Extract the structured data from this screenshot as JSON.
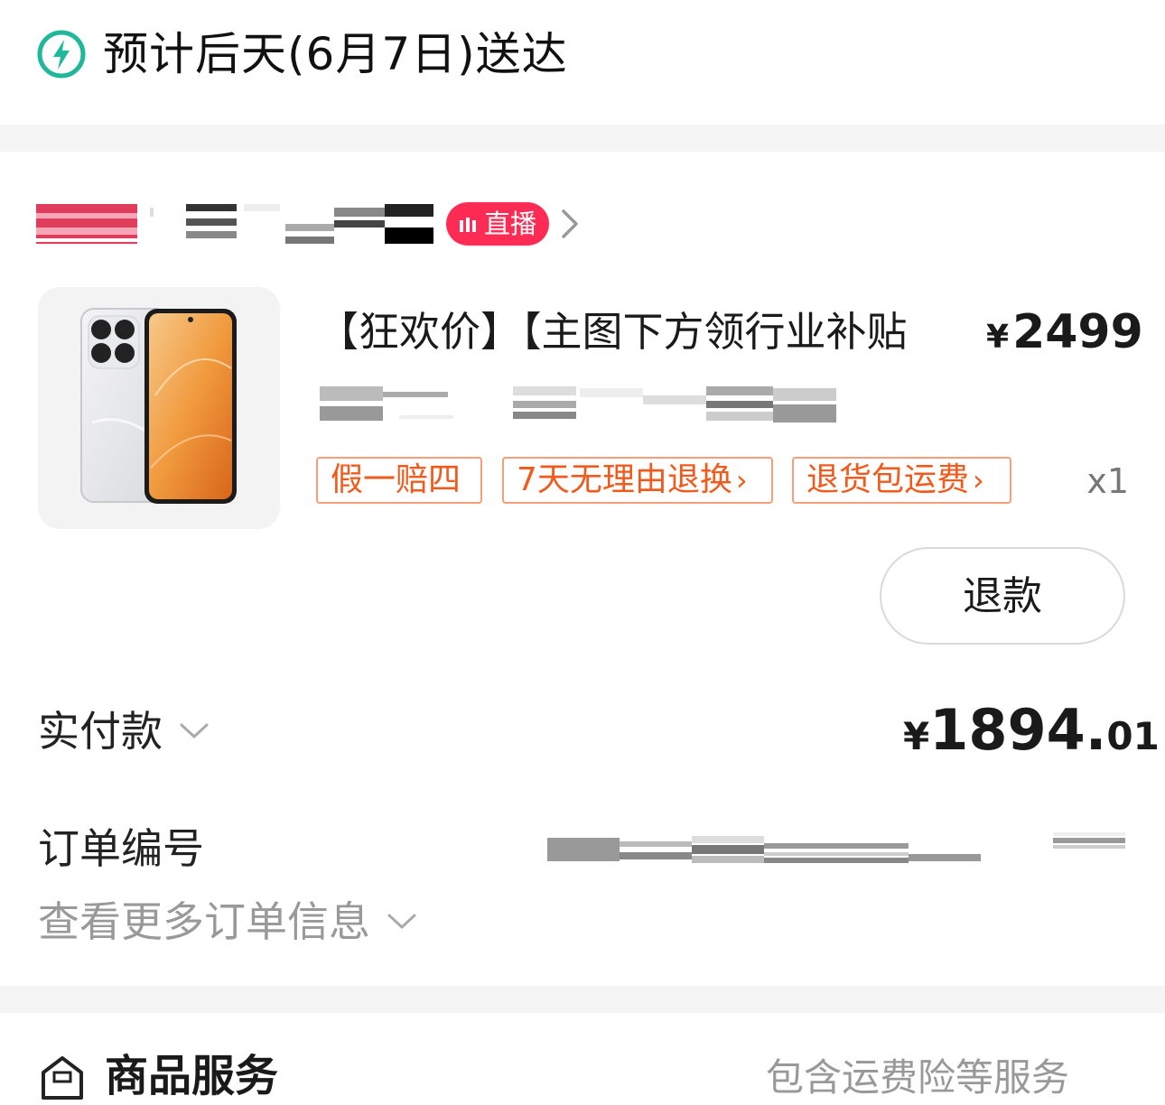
{
  "delivery": {
    "text": "预计后天(6月7日)送达"
  },
  "shop": {
    "live_badge": "直播"
  },
  "product": {
    "title": "【狂欢价】【主图下方领行业补贴",
    "currency": "¥",
    "price": "2499",
    "tags": [
      "假一赔四",
      "7天无理由退换",
      "退货包运费"
    ],
    "qty": "x1"
  },
  "actions": {
    "refund": "退款"
  },
  "payment": {
    "label": "实付款",
    "currency": "¥",
    "amount_int": "1894.",
    "amount_dec": "01"
  },
  "order": {
    "label": "订单编号",
    "more": "查看更多订单信息"
  },
  "service": {
    "title": "商品服务",
    "desc": "包含运费险等服务"
  },
  "colors": {
    "accent": "#fe2c55",
    "tag_text": "#f25a1c",
    "tag_border": "#f2a07a",
    "delivery_icon": "#1fb89a"
  }
}
